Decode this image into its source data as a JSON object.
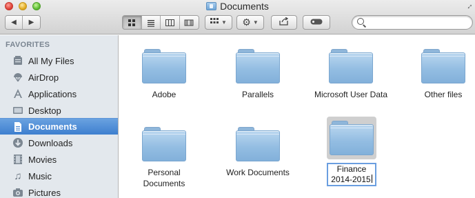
{
  "window": {
    "title": "Documents"
  },
  "toolbar": {
    "back_icon": "back-arrow-icon",
    "forward_icon": "forward-arrow-icon",
    "view_modes": [
      "icon-view-icon",
      "list-view-icon",
      "column-view-icon",
      "coverflow-view-icon"
    ],
    "active_view": "icon-view-icon",
    "arrange_icon": "arrange-icon",
    "action_icon": "gear-icon",
    "share_icon": "share-icon",
    "tags_icon": "tag-icon",
    "search_placeholder": "",
    "search_value": ""
  },
  "sidebar": {
    "heading": "FAVORITES",
    "items": [
      {
        "label": "All My Files",
        "icon": "all-files-icon",
        "selected": false
      },
      {
        "label": "AirDrop",
        "icon": "airdrop-icon",
        "selected": false
      },
      {
        "label": "Applications",
        "icon": "applications-icon",
        "selected": false
      },
      {
        "label": "Desktop",
        "icon": "desktop-icon",
        "selected": false
      },
      {
        "label": "Documents",
        "icon": "documents-icon",
        "selected": true
      },
      {
        "label": "Downloads",
        "icon": "downloads-icon",
        "selected": false
      },
      {
        "label": "Movies",
        "icon": "movies-icon",
        "selected": false
      },
      {
        "label": "Music",
        "icon": "music-icon",
        "selected": false
      },
      {
        "label": "Pictures",
        "icon": "pictures-icon",
        "selected": false
      }
    ]
  },
  "content": {
    "items": [
      {
        "label": "Adobe"
      },
      {
        "label": "Parallels"
      },
      {
        "label": "Microsoft User Data"
      },
      {
        "label": "Other files"
      },
      {
        "label": "Personal Documents"
      },
      {
        "label": "Work Documents"
      },
      {
        "label": "Finance 2014-2015",
        "editing": true
      }
    ]
  },
  "colors": {
    "selection_blue": "#3d7fcf",
    "folder_blue": "#93bde2",
    "sidebar_bg": "#e3e8ed"
  }
}
